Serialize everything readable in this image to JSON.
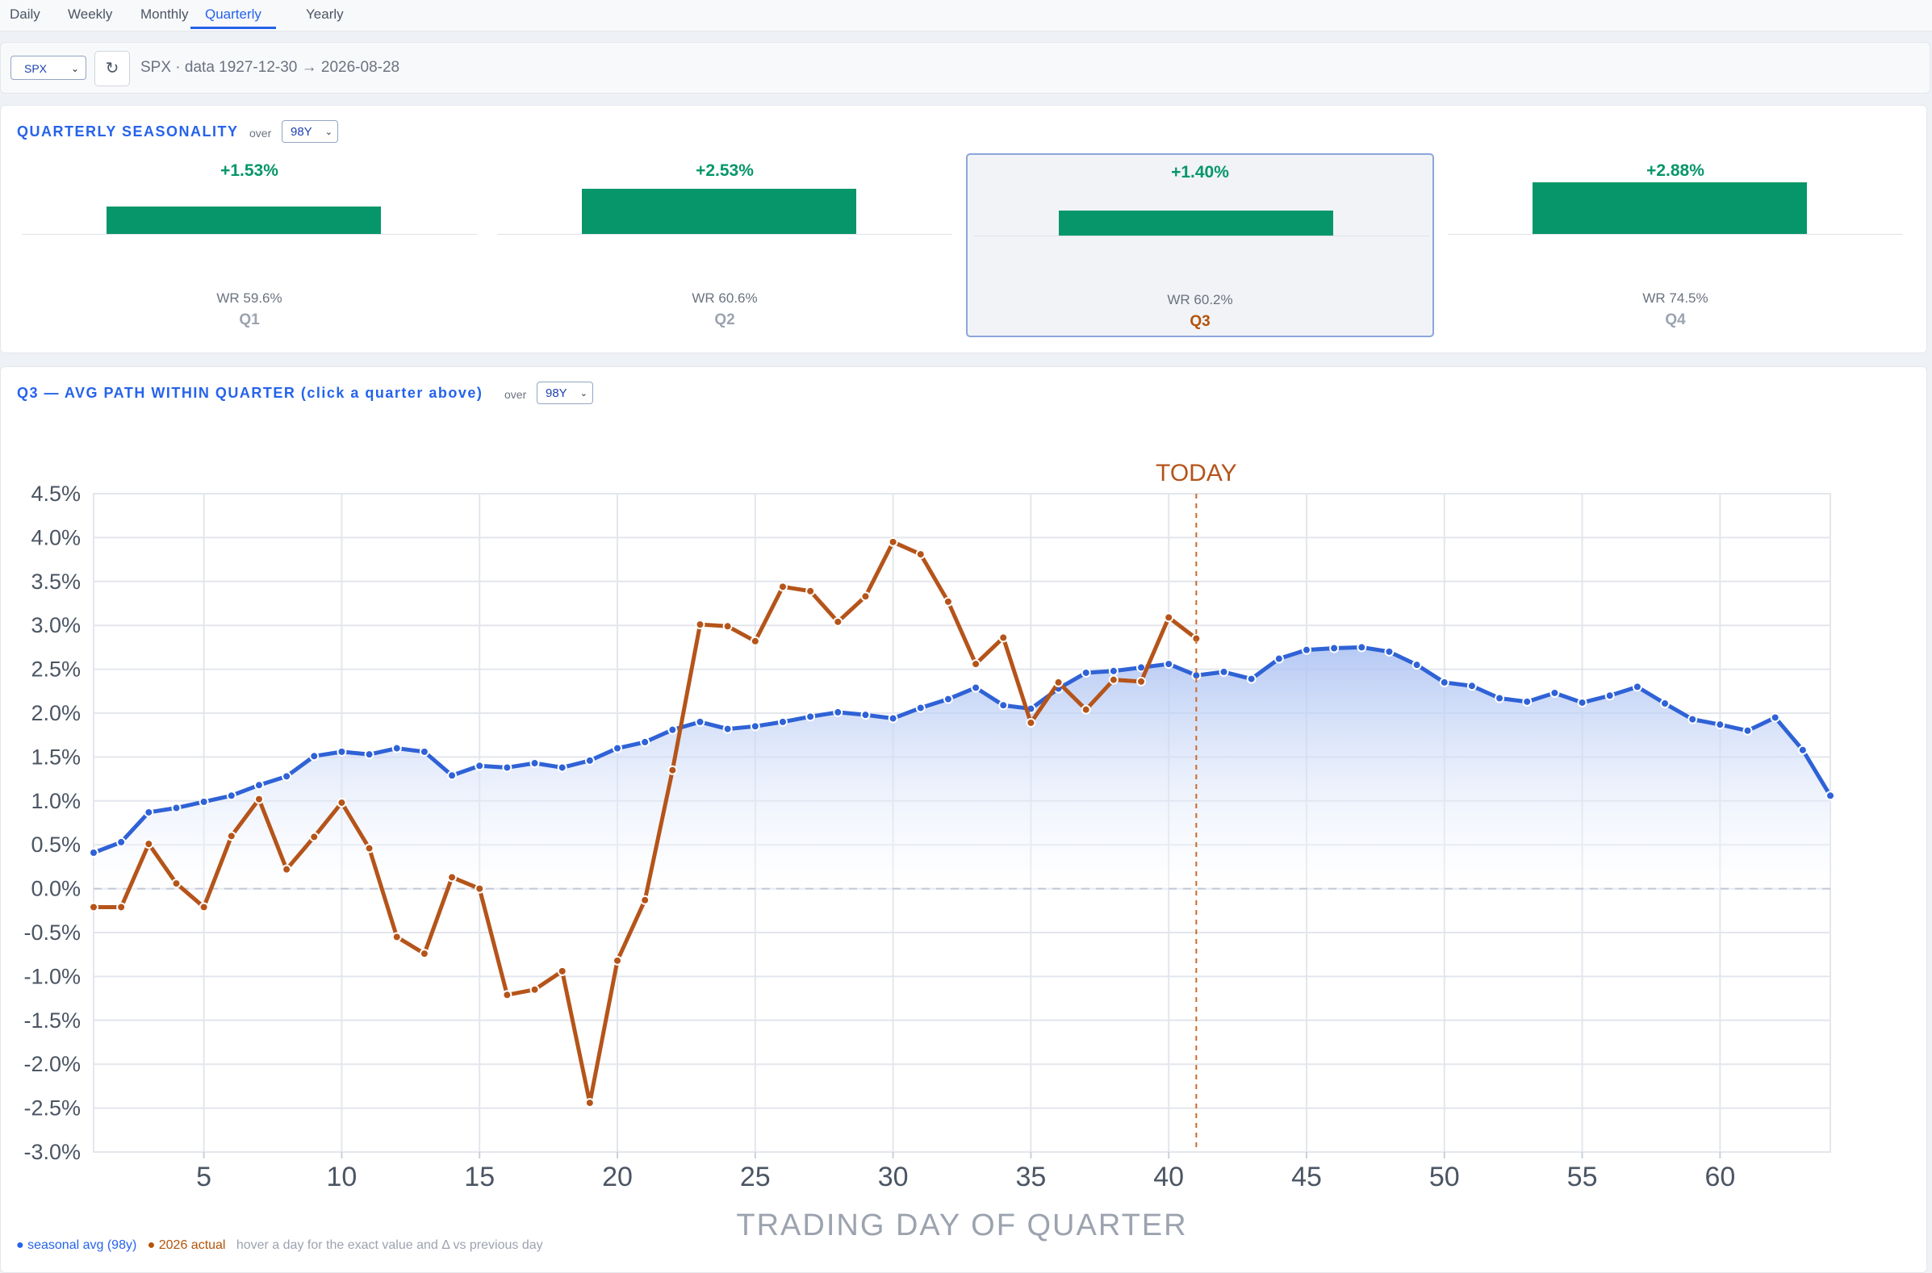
{
  "tabs": [
    {
      "label": "Daily",
      "active": false
    },
    {
      "label": "Weekly",
      "active": false
    },
    {
      "label": "Monthly",
      "active": false
    },
    {
      "label": "Quarterly",
      "active": true
    },
    {
      "label": "Yearly",
      "active": false
    }
  ],
  "toolbar": {
    "symbol": "SPX",
    "refresh_icon": "↻",
    "data_range": "SPX · data 1927-12-30 → 2026-08-28"
  },
  "seasonality": {
    "title": "QUARTERLY SEASONALITY",
    "over_label": "over",
    "lookback": "98Y",
    "quarters": [
      {
        "name": "Q1",
        "value_label": "+1.53%",
        "value": 1.53,
        "wr": "WR 59.6%",
        "selected": false
      },
      {
        "name": "Q2",
        "value_label": "+2.53%",
        "value": 2.53,
        "wr": "WR 60.6%",
        "selected": false
      },
      {
        "name": "Q3",
        "value_label": "+1.40%",
        "value": 1.4,
        "wr": "WR 60.2%",
        "selected": true
      },
      {
        "name": "Q4",
        "value_label": "+2.88%",
        "value": 2.88,
        "wr": "WR 74.5%",
        "selected": false
      }
    ]
  },
  "path": {
    "title": "Q3 — AVG PATH WITHIN QUARTER (click a quarter above)",
    "over_label": "over",
    "lookback": "98Y"
  },
  "chart_data": {
    "type": "line",
    "title": "",
    "xlabel": "TRADING DAY OF QUARTER",
    "ylabel": "",
    "xlim": [
      1,
      64
    ],
    "ylim": [
      -3.0,
      4.5
    ],
    "x_ticks": [
      5,
      10,
      15,
      20,
      25,
      30,
      35,
      40,
      45,
      50,
      55,
      60
    ],
    "y_ticks": [
      4.5,
      4.0,
      3.5,
      3.0,
      2.5,
      2.0,
      1.5,
      1.0,
      0.5,
      0.0,
      -0.5,
      -1.0,
      -1.5,
      -2.0,
      -2.5,
      -3.0
    ],
    "y_tick_labels": [
      "4.5%",
      "4.0%",
      "3.5%",
      "3.0%",
      "2.5%",
      "2.0%",
      "1.5%",
      "1.0%",
      "0.5%",
      "0.0%",
      "-0.5%",
      "-1.0%",
      "-1.5%",
      "-2.0%",
      "-2.5%",
      "-3.0%"
    ],
    "grid": true,
    "today_marker": {
      "x": 41,
      "label": "TODAY"
    },
    "series": [
      {
        "name": "seasonal avg (98y)",
        "color": "#2f62d6",
        "x_start": 1,
        "values": [
          0.41,
          0.53,
          0.87,
          0.92,
          0.99,
          1.06,
          1.18,
          1.28,
          1.51,
          1.56,
          1.53,
          1.6,
          1.56,
          1.29,
          1.4,
          1.38,
          1.43,
          1.38,
          1.46,
          1.6,
          1.67,
          1.81,
          1.9,
          1.82,
          1.85,
          1.9,
          1.96,
          2.01,
          1.98,
          1.94,
          2.06,
          2.16,
          2.29,
          2.09,
          2.05,
          2.28,
          2.46,
          2.48,
          2.52,
          2.56,
          2.43,
          2.47,
          2.39,
          2.62,
          2.72,
          2.74,
          2.75,
          2.7,
          2.55,
          2.35,
          2.31,
          2.17,
          2.13,
          2.23,
          2.12,
          2.2,
          2.3,
          2.11,
          1.93,
          1.87,
          1.8,
          1.95,
          1.58,
          1.06
        ]
      },
      {
        "name": "2026 actual",
        "color": "#b5541a",
        "x_start": 1,
        "values": [
          -0.21,
          -0.21,
          0.51,
          0.06,
          -0.21,
          0.6,
          1.02,
          0.22,
          0.59,
          0.98,
          0.46,
          -0.55,
          -0.74,
          0.13,
          0.0,
          -1.21,
          -1.15,
          -0.94,
          -2.44,
          -0.82,
          -0.13,
          1.35,
          3.01,
          2.99,
          2.82,
          3.44,
          3.39,
          3.04,
          3.33,
          3.95,
          3.81,
          3.27,
          2.56,
          2.86,
          1.89,
          2.35,
          2.04,
          2.38,
          2.36,
          3.09,
          2.85
        ]
      }
    ]
  },
  "legend": {
    "seasonal": "● seasonal avg (98y)",
    "actual": "● 2026 actual",
    "hint": "hover a day for the exact value and Δ vs previous day"
  }
}
